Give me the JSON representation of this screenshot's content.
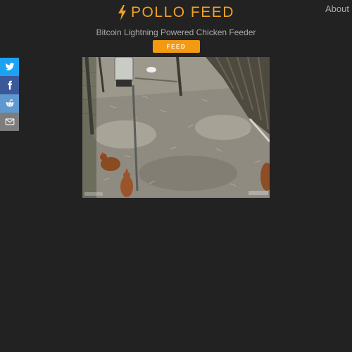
{
  "nav": {
    "about_label": "About"
  },
  "header": {
    "icon": "lightning-bolt-icon",
    "title": "POLLO FEED",
    "subtitle": "Bitcoin Lightning Powered Chicken Feeder"
  },
  "feed_button": {
    "label": "FEED"
  },
  "share": [
    {
      "network": "twitter",
      "icon": "twitter-icon",
      "color": "#1da1f2"
    },
    {
      "network": "facebook",
      "icon": "facebook-icon",
      "color": "#3b5998"
    },
    {
      "network": "reddit",
      "icon": "reddit-icon",
      "color": "#5f99cf"
    },
    {
      "network": "email",
      "icon": "email-icon",
      "color": "#7d7d7d"
    }
  ],
  "camera": {
    "description": "live chicken coop camera feed"
  },
  "colors": {
    "accent": "#f2a024",
    "background": "#222222",
    "muted_text": "#aaaaaa"
  }
}
